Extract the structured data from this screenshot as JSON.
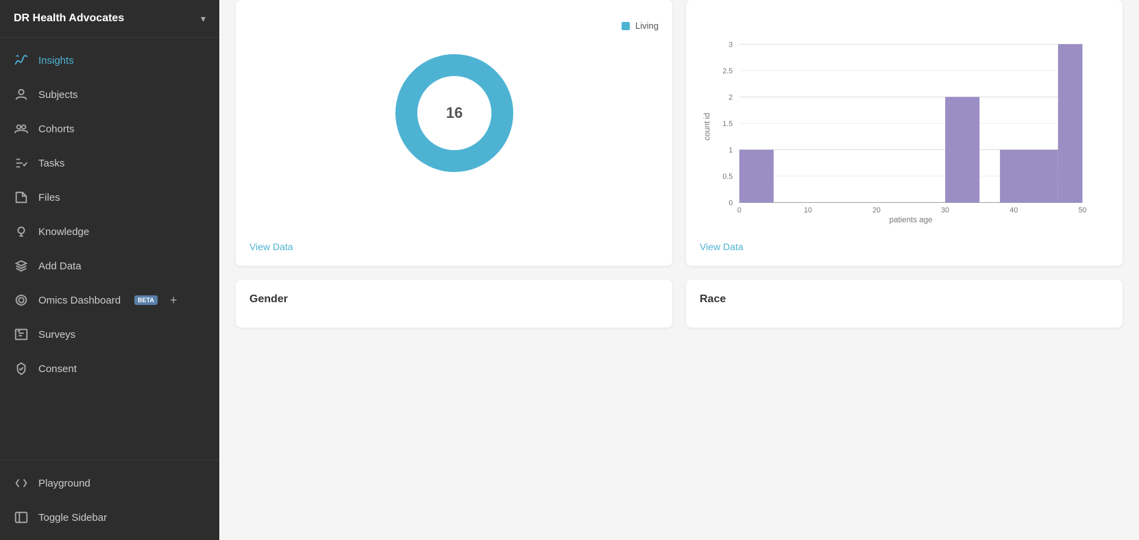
{
  "sidebar": {
    "header": {
      "title": "DR Health Advocates",
      "chevron": "▾"
    },
    "items": [
      {
        "id": "insights",
        "label": "Insights",
        "icon": "insights",
        "active": true
      },
      {
        "id": "subjects",
        "label": "Subjects",
        "icon": "subjects",
        "active": false
      },
      {
        "id": "cohorts",
        "label": "Cohorts",
        "icon": "cohorts",
        "active": false
      },
      {
        "id": "tasks",
        "label": "Tasks",
        "icon": "tasks",
        "active": false
      },
      {
        "id": "files",
        "label": "Files",
        "icon": "files",
        "active": false
      },
      {
        "id": "knowledge",
        "label": "Knowledge",
        "icon": "knowledge",
        "active": false
      },
      {
        "id": "add-data",
        "label": "Add Data",
        "icon": "add-data",
        "active": false
      },
      {
        "id": "omics",
        "label": "Omics Dashboard",
        "icon": "omics",
        "active": false,
        "beta": true
      },
      {
        "id": "surveys",
        "label": "Surveys",
        "icon": "surveys",
        "active": false
      },
      {
        "id": "consent",
        "label": "Consent",
        "icon": "consent",
        "active": false
      }
    ],
    "footer_items": [
      {
        "id": "playground",
        "label": "Playground",
        "icon": "playground"
      },
      {
        "id": "toggle-sidebar",
        "label": "Toggle Sidebar",
        "icon": "toggle"
      }
    ]
  },
  "main": {
    "donut_card": {
      "legend_label": "Living",
      "legend_color": "#4eb3d3",
      "center_value": "16",
      "view_data": "View Data",
      "donut_color": "#4eb3d3",
      "donut_bg": "#fff"
    },
    "bar_card": {
      "y_label": "count id",
      "x_label": "patients age",
      "view_data": "View Data",
      "bar_color": "#9b8ec4",
      "y_ticks": [
        0,
        0.5,
        1,
        1.5,
        2,
        2.5,
        3
      ],
      "x_ticks": [
        0,
        10,
        20,
        30,
        40,
        50
      ],
      "bars": [
        {
          "x_start": 0,
          "x_end": 5,
          "value": 1
        },
        {
          "x_start": 30,
          "x_end": 35,
          "value": 2
        },
        {
          "x_start": 38,
          "x_end": 43,
          "value": 1
        },
        {
          "x_start": 43,
          "x_end": 48,
          "value": 1
        },
        {
          "x_start": 48,
          "x_end": 53,
          "value": 3
        }
      ]
    },
    "gender_card": {
      "title": "Gender"
    },
    "race_card": {
      "title": "Race"
    }
  }
}
